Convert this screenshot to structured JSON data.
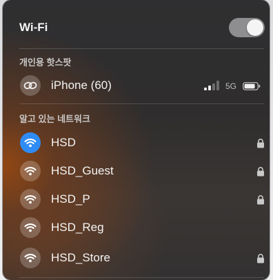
{
  "header": {
    "title": "Wi-Fi",
    "toggle_on": true
  },
  "hotspot_section": {
    "label": "개인용 핫스팟",
    "device": {
      "name": "iPhone (60)",
      "icon": "link-icon",
      "network_type": "5G",
      "signal_bars": 2,
      "signal_max": 4
    }
  },
  "known_section": {
    "label": "알고 있는 네트워크",
    "networks": [
      {
        "name": "HSD",
        "connected": true,
        "locked": true
      },
      {
        "name": "HSD_Guest",
        "connected": false,
        "locked": true
      },
      {
        "name": "HSD_P",
        "connected": false,
        "locked": true
      },
      {
        "name": "HSD_Reg",
        "connected": false,
        "locked": false
      },
      {
        "name": "HSD_Store",
        "connected": false,
        "locked": true
      }
    ]
  },
  "colors": {
    "accent": "#2f8cf5",
    "toggle_track": "#8e8e90"
  }
}
